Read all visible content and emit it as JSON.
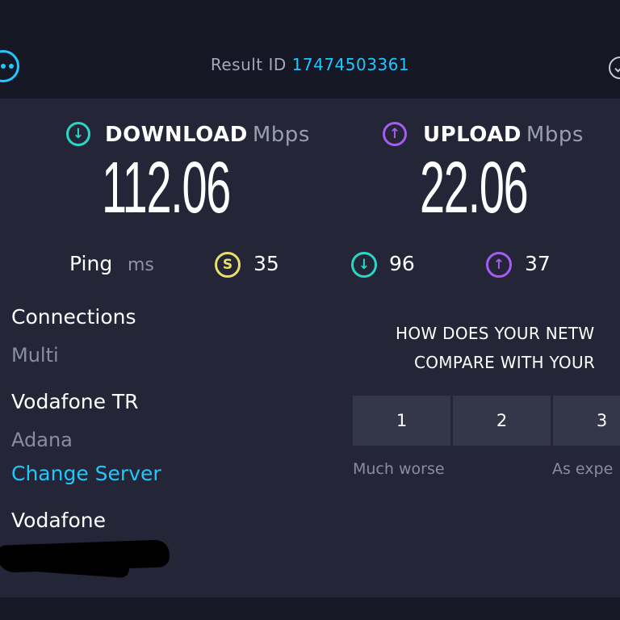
{
  "header": {
    "result_id_label": "Result ID",
    "result_id_value": "17474503361",
    "menu_icon": "more-dots-icon",
    "right_icon": "check-circle-icon"
  },
  "download": {
    "label": "DOWNLOAD",
    "unit": "Mbps",
    "value": "112.06",
    "icon": "download-arrow-icon",
    "color": "#2ad6c4"
  },
  "upload": {
    "label": "UPLOAD",
    "unit": "Mbps",
    "value": "22.06",
    "icon": "upload-arrow-icon",
    "color": "#a55cf0"
  },
  "ping": {
    "label": "Ping",
    "unit": "ms",
    "idle_value": "35",
    "download_value": "96",
    "upload_value": "37",
    "idle_color": "#e8e06a"
  },
  "connections": {
    "label": "Connections",
    "value": "Multi"
  },
  "server": {
    "name": "Vodafone TR",
    "location": "Adana",
    "change_label": "Change Server"
  },
  "provider": {
    "name": "Vodafone"
  },
  "survey": {
    "question_line1": "HOW DOES YOUR NETW",
    "question_line2": "COMPARE WITH YOUR",
    "options": [
      "1",
      "2",
      "3"
    ],
    "caption_low": "Much worse",
    "caption_mid": "As expe"
  },
  "colors": {
    "accent": "#1ec8ff",
    "background": "#242637",
    "header_bg": "#161725"
  }
}
